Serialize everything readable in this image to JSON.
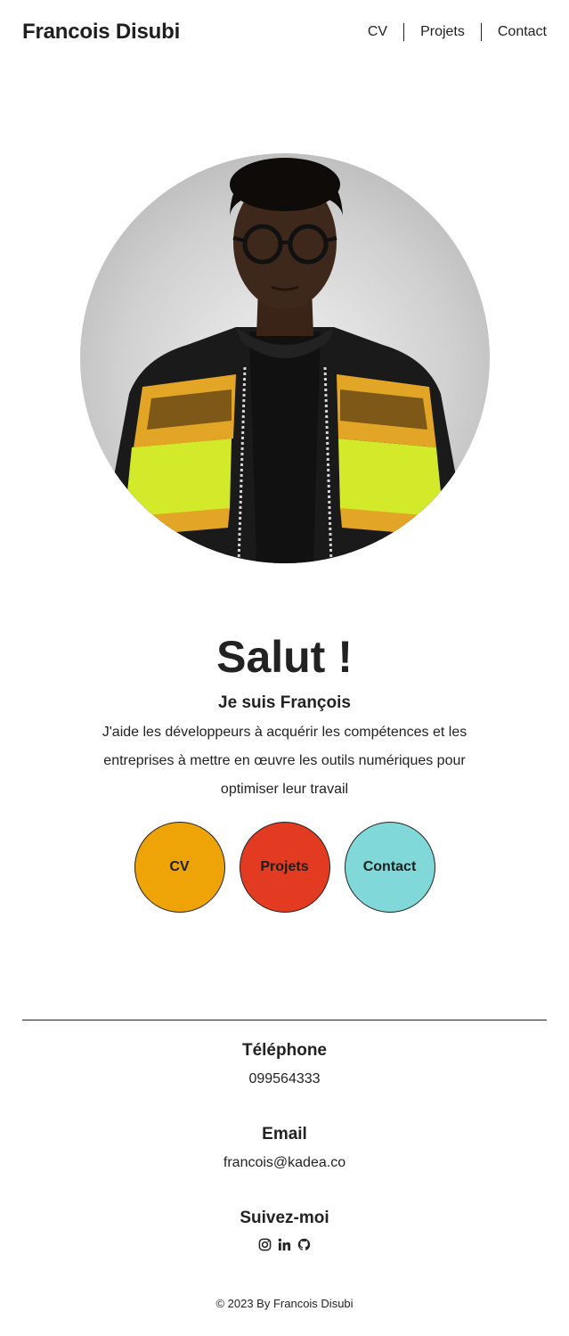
{
  "header": {
    "brand": "Francois Disubi",
    "nav": [
      {
        "label": "CV"
      },
      {
        "label": "Projets"
      },
      {
        "label": "Contact"
      }
    ]
  },
  "hero": {
    "title": "Salut !",
    "subtitle": "Je suis François",
    "description": "J'aide les développeurs à acquérir les compétences et les entreprises à mettre en œuvre les outils numériques pour optimiser leur travail",
    "buttons": [
      {
        "label": "CV",
        "color": "#EEA307"
      },
      {
        "label": "Projets",
        "color": "#E33A22"
      },
      {
        "label": "Contact",
        "color": "#80D8D8"
      }
    ]
  },
  "contact": {
    "phone_title": "Téléphone",
    "phone": "099564333",
    "email_title": "Email",
    "email": "francois@kadea.co",
    "follow_title": "Suivez-moi",
    "socials": [
      "instagram-icon",
      "linkedin-icon",
      "github-icon"
    ]
  },
  "footer": {
    "copyright": "© 2023 By Francois Disubi"
  }
}
